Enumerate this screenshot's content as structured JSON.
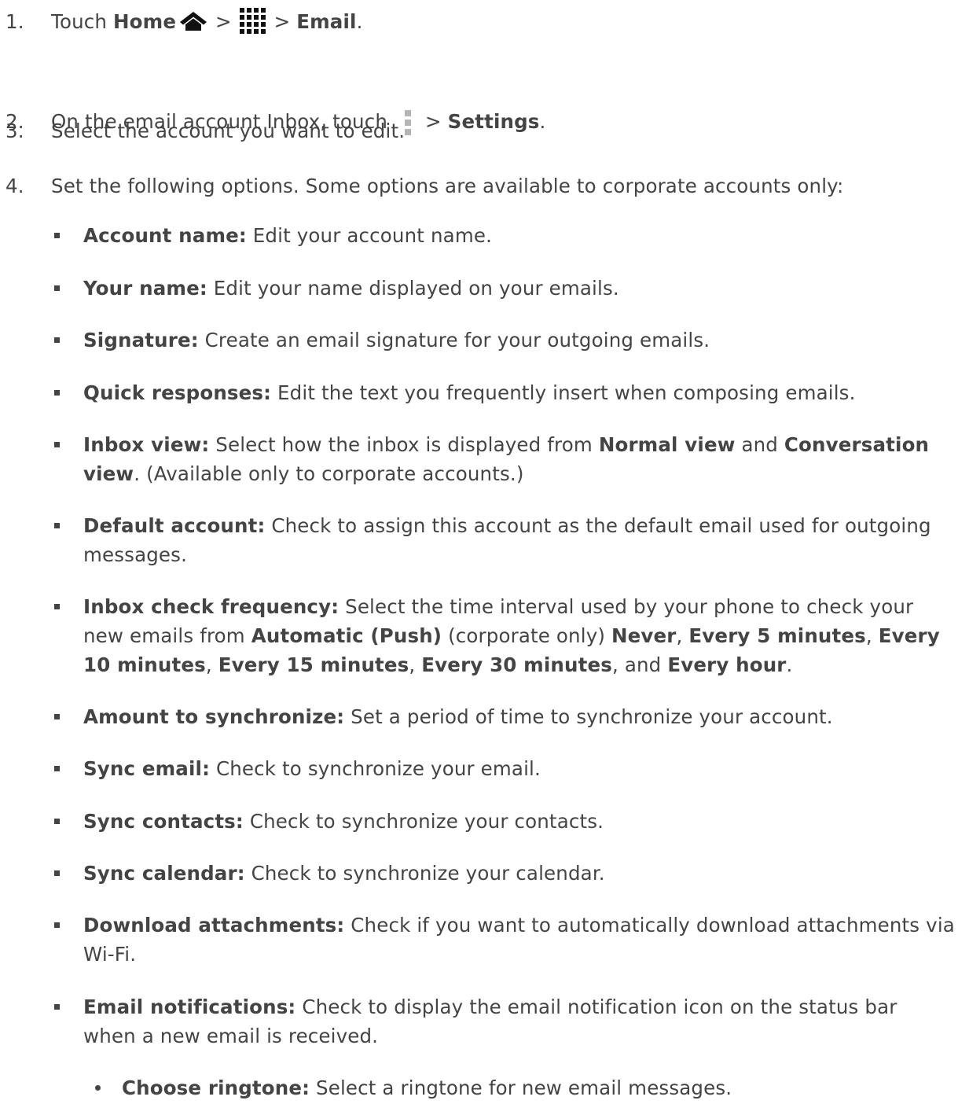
{
  "steps": [
    {
      "num": "1.",
      "prefix": "Touch ",
      "home": "Home",
      "sep1": " > ",
      "sep2": " > ",
      "email": "Email",
      "end": "."
    },
    {
      "num": "2.",
      "prefix": "On the email account Inbox, touch",
      "sep": "> ",
      "settings": "Settings",
      "end": "."
    },
    {
      "num": "3.",
      "text": "Select the account you want to edit."
    },
    {
      "num": "4.",
      "text": "Set the following options. Some options are available to corporate accounts only:"
    }
  ],
  "options": [
    {
      "label": "Account name:",
      "desc": " Edit your account name."
    },
    {
      "label": "Your name:",
      "desc": " Edit your name displayed on your emails."
    },
    {
      "label": "Signature:",
      "desc": " Create an email signature for your outgoing emails."
    },
    {
      "label": "Quick responses:",
      "desc": " Edit the text you frequently insert when composing emails."
    },
    {
      "label": "Inbox view:",
      "d1": " Select how the inbox is displayed from ",
      "b1": "Normal view",
      "d2": " and ",
      "b2": "Conversation view",
      "d3": ". (Available only to corporate accounts.)"
    },
    {
      "label": "Default account:",
      "desc": " Check to assign this account as the default email used for outgoing messages."
    },
    {
      "label": "Inbox check frequency:",
      "d1": " Select the time interval used by your phone to check your new emails from ",
      "b1": "Automatic (Push)",
      "d2": " (corporate only) ",
      "b2": "Never",
      "c2": ", ",
      "b3": "Every 5 minutes",
      "c3": ", ",
      "b4": "Every 10 minutes",
      "c4": ", ",
      "b5": "Every 15 minutes",
      "c5": ", ",
      "b6": "Every 30 minutes",
      "c6": ", and ",
      "b7": "Every hour",
      "c7": "."
    },
    {
      "label": "Amount to synchronize:",
      "desc": " Set a period of time to synchronize your account."
    },
    {
      "label": "Sync email:",
      "desc": " Check to synchronize your email."
    },
    {
      "label": "Sync contacts:",
      "desc": " Check to synchronize your contacts."
    },
    {
      "label": "Sync calendar:",
      "desc": " Check to synchronize your calendar."
    },
    {
      "label": "Download attachments:",
      "desc": " Check if you want to automatically download attachments via Wi-Fi."
    },
    {
      "label": "Email notifications:",
      "desc": " Check to display the email notification icon on the status bar when a new email is received."
    }
  ],
  "sub_options": [
    {
      "label": "Choose ringtone:",
      "desc": " Select a ringtone for new email messages."
    }
  ],
  "icons": {
    "home": "home-icon",
    "apps": "apps-grid-icon",
    "menu": "menu-icon"
  },
  "colors": {
    "text": "#444444",
    "menu_icon": "#b5b5b5"
  }
}
